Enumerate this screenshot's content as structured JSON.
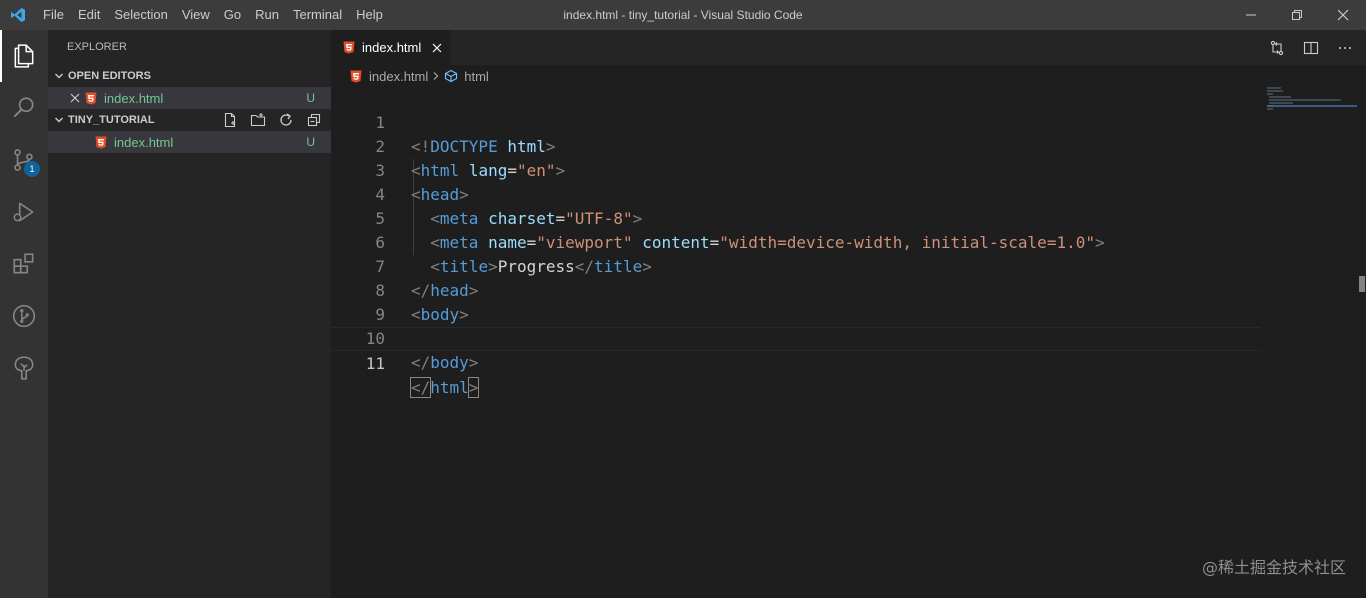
{
  "menu": [
    "File",
    "Edit",
    "Selection",
    "View",
    "Go",
    "Run",
    "Terminal",
    "Help"
  ],
  "window_title": "index.html - tiny_tutorial - Visual Studio Code",
  "activity": {
    "scm_badge": "1"
  },
  "sidebar": {
    "title": "EXPLORER",
    "open_editors": {
      "label": "OPEN EDITORS",
      "file": "index.html",
      "status": "U"
    },
    "folder": {
      "label": "TINY_TUTORIAL",
      "file": "index.html",
      "status": "U"
    }
  },
  "tab": {
    "label": "index.html"
  },
  "breadcrumb": {
    "file": "index.html",
    "symbol": "html"
  },
  "code": {
    "line_numbers": [
      "1",
      "2",
      "3",
      "4",
      "5",
      "6",
      "7",
      "8",
      "9",
      "10",
      "11"
    ],
    "l1": {
      "open": "<!",
      "tag": "DOCTYPE",
      "attr": "html",
      "close": ">"
    },
    "l2": {
      "open": "<",
      "tag": "html",
      "attr": "lang",
      "eq": "=",
      "val": "\"en\"",
      "close": ">"
    },
    "l3": {
      "open": "<",
      "tag": "head",
      "close": ">"
    },
    "l4": {
      "open": "<",
      "tag": "meta",
      "attr": "charset",
      "eq": "=",
      "val": "\"UTF-8\"",
      "close": ">"
    },
    "l5": {
      "open": "<",
      "tag": "meta",
      "attr1": "name",
      "eq1": "=",
      "val1": "\"viewport\"",
      "attr2": "content",
      "eq2": "=",
      "val2": "\"width=device-width, initial-scale=1.0\"",
      "close": ">"
    },
    "l6": {
      "open": "<",
      "tag": "title",
      "close": ">",
      "text": "Progress",
      "open2": "</",
      "tag2": "title",
      "close2": ">"
    },
    "l7": {
      "open": "</",
      "tag": "head",
      "close": ">"
    },
    "l8": {
      "open": "<",
      "tag": "body",
      "close": ">"
    },
    "l10": {
      "open": "</",
      "tag": "body",
      "close": ">"
    },
    "l11": {
      "open": "</",
      "tag": "html",
      "close": ">"
    }
  },
  "watermark": "@稀土掘金技术社区"
}
